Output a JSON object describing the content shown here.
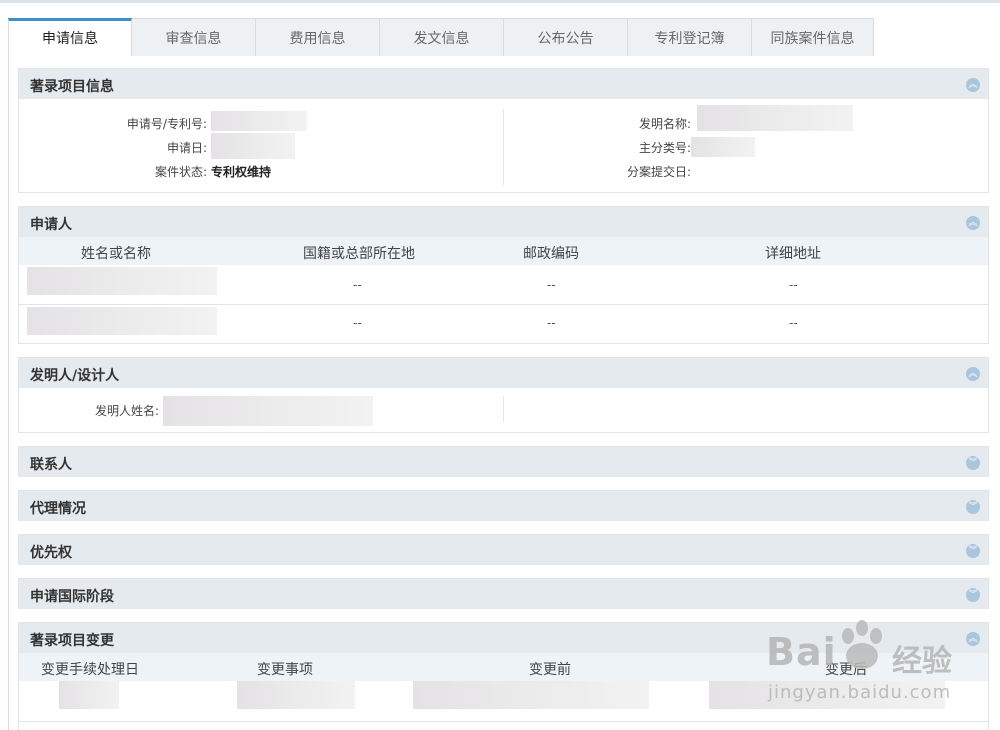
{
  "tabs": [
    "申请信息",
    "审查信息",
    "费用信息",
    "发文信息",
    "公布公告",
    "专利登记簿",
    "同族案件信息"
  ],
  "bibliographic": {
    "title": "著录项目信息",
    "app_no_label": "申请号/专利号:",
    "app_date_label": "申请日:",
    "status_label": "案件状态:",
    "status_value": "专利权维持",
    "invention_name_label": "发明名称:",
    "main_class_label": "主分类号:",
    "division_date_label": "分案提交日:"
  },
  "applicant": {
    "title": "申请人",
    "columns": [
      "姓名或名称",
      "国籍或总部所在地",
      "邮政编码",
      "详细地址"
    ],
    "rows": [
      [
        "--",
        "--",
        "--"
      ],
      [
        "--",
        "--",
        "--"
      ]
    ]
  },
  "inventor": {
    "title": "发明人/设计人",
    "name_label": "发明人姓名:"
  },
  "collapsed_sections": [
    "联系人",
    "代理情况",
    "优先权",
    "申请国际阶段"
  ],
  "changes": {
    "title": "著录项目变更",
    "columns": [
      "变更手续处理日",
      "变更事项",
      "变更前",
      "变更后"
    ]
  },
  "toggle_icons": {
    "expanded": "chevron-up-icon",
    "collapsed": "chevron-down-icon"
  },
  "colors": {
    "accent": "#3d8fd0",
    "section_header": "#e5eaef",
    "toggle": "#a9c6de"
  },
  "watermark": {
    "brand": "Bai",
    "brand_cn": "经验",
    "url": "jingyan.baidu.com"
  }
}
